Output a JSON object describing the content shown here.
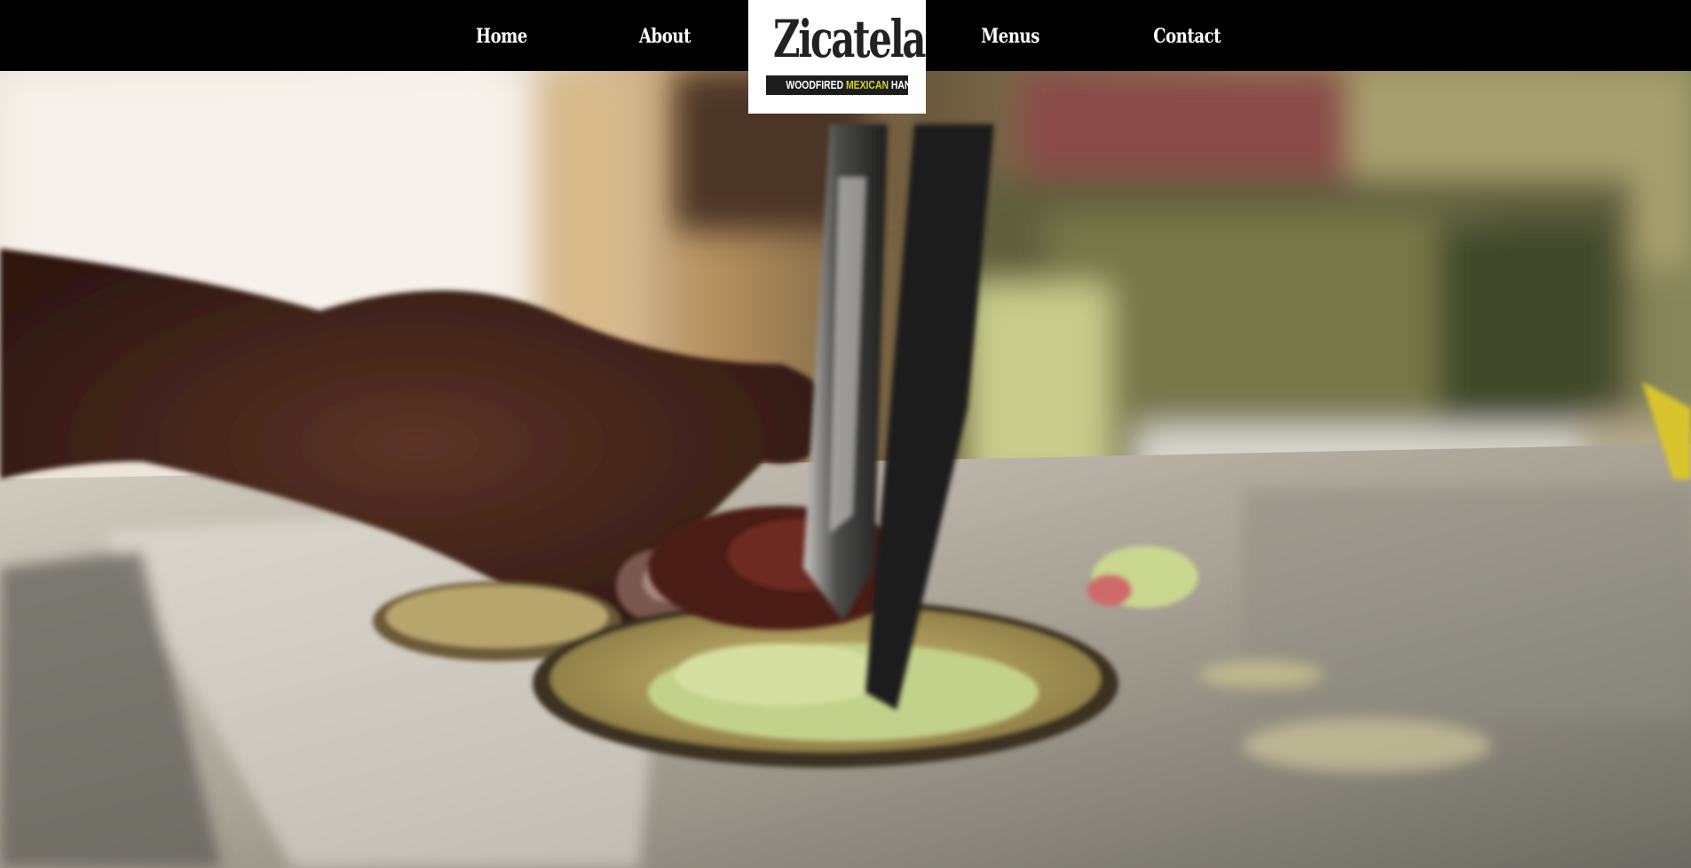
{
  "nav": {
    "home": "Home",
    "about": "About",
    "menus": "Menus",
    "contact": "Contact"
  },
  "logo": {
    "wordmark": "Zicatela",
    "tag_left": "WOODFIRED",
    "tag_mid": "MEXICAN",
    "tag_right": "HANDMADE"
  },
  "hero": {
    "media": "taco-prep-video-still"
  },
  "colors": {
    "topbar": "#000000",
    "nav_text": "#ffffff",
    "logo_bg": "#ffffff",
    "logo_accent": "#d6d21a"
  }
}
